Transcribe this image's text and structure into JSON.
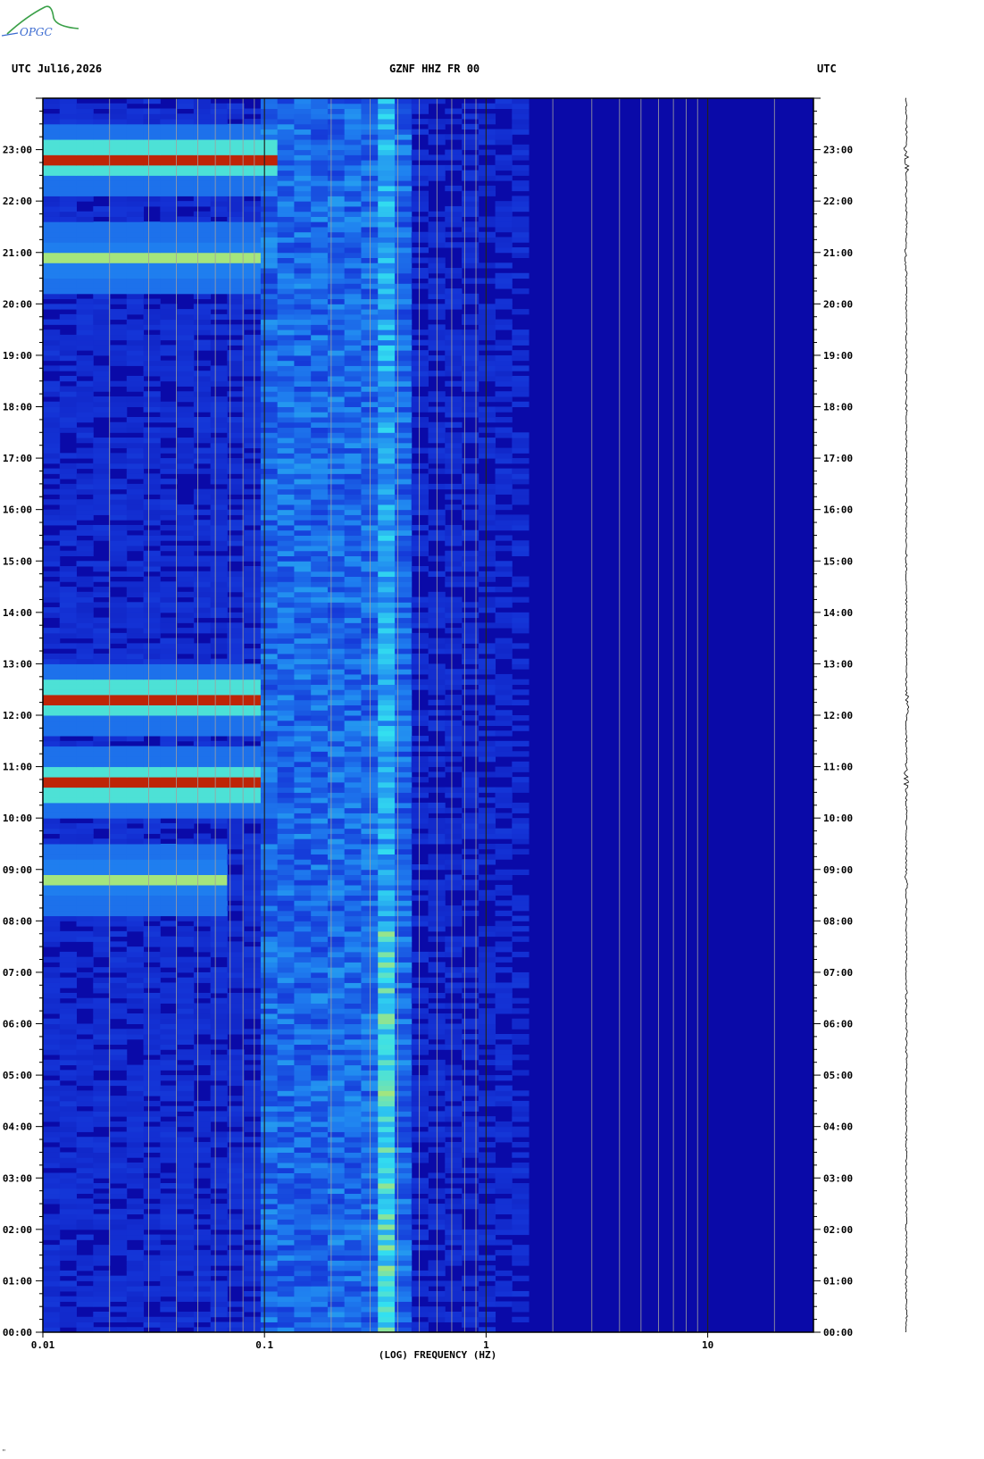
{
  "logo": {
    "text": "OPGC"
  },
  "header": {
    "left": "UTC  Jul16,2026",
    "center": "GZNF HHZ FR 00",
    "right": "UTC"
  },
  "footer": {
    "corner_mark": "\""
  },
  "colors": {
    "background": "#0a0aa8",
    "low": "#1433d6",
    "mid": "#1f80f0",
    "cyan": "#33e0f0",
    "yellow": "#f0e830",
    "orange": "#f07818",
    "red": "#a80000",
    "logo_green": "#3aa048",
    "logo_blue": "#3a6ad0"
  },
  "chart_data": {
    "type": "heatmap",
    "xlabel": "(LOG) FREQUENCY (HZ)",
    "x_scale": "log",
    "xlim": [
      0.01,
      30
    ],
    "x_tick_labels": [
      "0.01",
      "0.1",
      "1",
      "10"
    ],
    "y_tick_labels": [
      "00:00",
      "01:00",
      "02:00",
      "03:00",
      "04:00",
      "05:00",
      "06:00",
      "07:00",
      "08:00",
      "09:00",
      "10:00",
      "11:00",
      "12:00",
      "13:00",
      "14:00",
      "15:00",
      "16:00",
      "17:00",
      "18:00",
      "19:00",
      "20:00",
      "21:00",
      "22:00",
      "23:00"
    ],
    "ylim_hours": [
      0,
      24
    ],
    "grid": true,
    "noise_band_hz": [
      0.12,
      0.45
    ],
    "microseism_peak_hz": 0.35,
    "events": [
      {
        "time_hours": 22.8,
        "max_freq_hz": 0.12,
        "intensity": "strong"
      },
      {
        "time_hours": 20.9,
        "max_freq_hz": 0.1,
        "intensity": "moderate"
      },
      {
        "time_hours": 12.3,
        "max_freq_hz": 0.1,
        "intensity": "strong"
      },
      {
        "time_hours": 10.7,
        "max_freq_hz": 0.1,
        "intensity": "strong"
      },
      {
        "time_hours": 8.8,
        "max_freq_hz": 0.07,
        "intensity": "moderate"
      }
    ]
  }
}
